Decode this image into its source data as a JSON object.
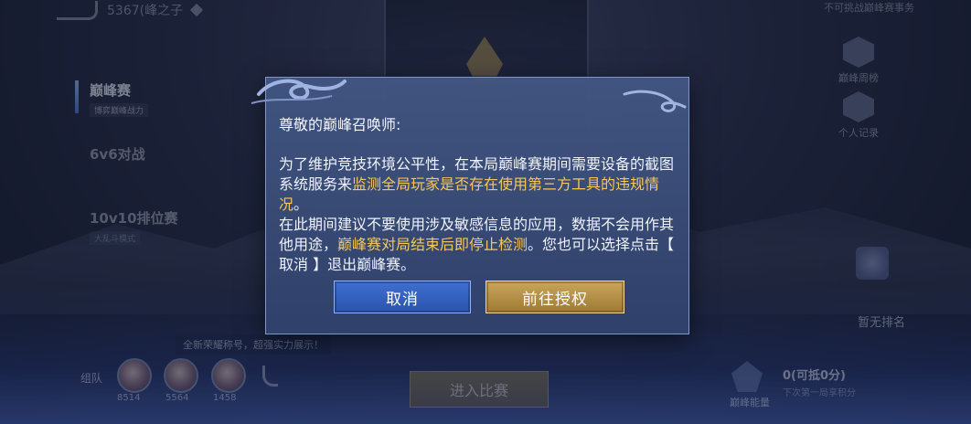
{
  "topbar": {
    "title": "5367(峰之子",
    "right_note": "不可挑战巅峰赛事务"
  },
  "sidebar": {
    "items": [
      {
        "name": "巅峰赛",
        "sub": "博弈巅峰战力"
      },
      {
        "name": "6v6对战",
        "sub": ""
      },
      {
        "name": "10v10排位赛",
        "sub": "大乱斗模式"
      }
    ]
  },
  "right_panel": {
    "items": [
      {
        "label": "巅峰周榜",
        "icon": "trophy-hex-icon"
      },
      {
        "label": "个人记录",
        "icon": "chevron-hex-icon"
      }
    ],
    "rank_text": "暂无排名"
  },
  "bottom": {
    "note": "全新荣耀称号，超强实力展示！",
    "teammates_label": "组队",
    "teammate_scores": [
      "8514",
      "5564",
      "1458"
    ],
    "enter_button": "进入比赛",
    "energy_label": "巅峰能量",
    "energy_value": "0(可抵0分)",
    "energy_desc": "下次第一局享积分"
  },
  "dialog": {
    "greeting": "尊敬的巅峰召唤师:",
    "p1_a": "为了维护竞技环境公平性，在本局巅峰赛期间需要设备的截图系统服务来",
    "p1_highlight": "监测全局玩家是否存在使用第三方工具的违规情况",
    "p1_end": "。",
    "p2_a": "在此期间建议不要使用涉及敏感信息的应用，数据不会用作其他用途，",
    "p2_highlight": "巅峰赛对局结束后即停止检测",
    "p2_b": "。您也可以选择点击【 取消 】退出巅峰赛。",
    "cancel_label": "取消",
    "confirm_label": "前往授权"
  },
  "colors": {
    "highlight": "#f6c75a",
    "cancel_button": "#3f6fd1",
    "confirm_button": "#c9a55b"
  }
}
